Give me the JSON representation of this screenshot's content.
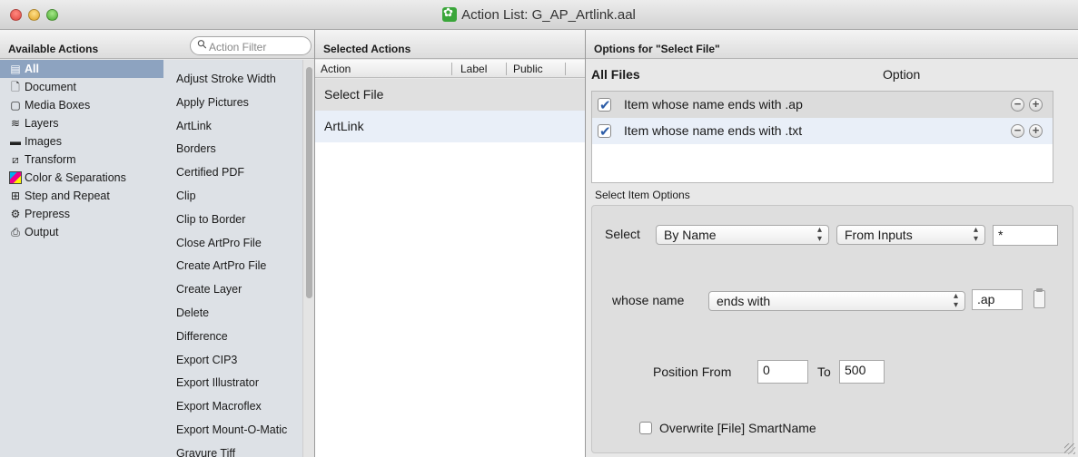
{
  "window": {
    "title": "Action List: G_AP_Artlink.aal"
  },
  "available": {
    "header": "Available Actions",
    "filter_placeholder": "Action Filter",
    "categories": [
      {
        "label": "All",
        "icon": "list-icon",
        "selected": true
      },
      {
        "label": "Document",
        "icon": "document-icon"
      },
      {
        "label": "Media Boxes",
        "icon": "media-box-icon"
      },
      {
        "label": "Layers",
        "icon": "layers-icon"
      },
      {
        "label": "Images",
        "icon": "image-icon"
      },
      {
        "label": "Transform",
        "icon": "transform-icon"
      },
      {
        "label": "Color & Separations",
        "icon": "color-separation-icon"
      },
      {
        "label": "Step and Repeat",
        "icon": "grid-icon"
      },
      {
        "label": "Prepress",
        "icon": "gear-icon"
      },
      {
        "label": "Output",
        "icon": "printer-icon"
      }
    ],
    "actions": [
      "Adjust Stroke Width",
      "Apply Pictures",
      "ArtLink",
      "Borders",
      "Certified PDF",
      "Clip",
      "Clip to Border",
      "Close ArtPro File",
      "Create ArtPro File",
      "Create Layer",
      "Delete",
      "Difference",
      "Export CIP3",
      "Export Illustrator",
      "Export Macroflex",
      "Export Mount-O-Matic",
      "Gravure Tiff"
    ]
  },
  "selected": {
    "header": "Selected Actions",
    "columns": [
      "Action",
      "Label",
      "Public"
    ],
    "rows": [
      "Select File",
      "ArtLink"
    ]
  },
  "options": {
    "header": "Options for \"Select File\"",
    "files_header": "All Files",
    "option_header": "Option",
    "files": [
      {
        "label": "Item whose name ends with .ap",
        "checked": true
      },
      {
        "label": "Item whose name ends with .txt",
        "checked": true
      }
    ],
    "select_item_options": "Select Item Options",
    "select_label": "Select",
    "select_by": "By Name",
    "select_from": "From Inputs",
    "select_value": "*",
    "whose_name_label": "whose name",
    "whose_name_op": "ends with",
    "whose_name_value": ".ap",
    "position_from_label": "Position From",
    "position_from_value": "0",
    "to_label": "To",
    "to_value": "500",
    "overwrite_label": "Overwrite [File] SmartName"
  },
  "colors": {
    "selection": "#8da3c0",
    "sidebar_bg": "#dde1e6",
    "alt_row": "#e9eff8"
  }
}
